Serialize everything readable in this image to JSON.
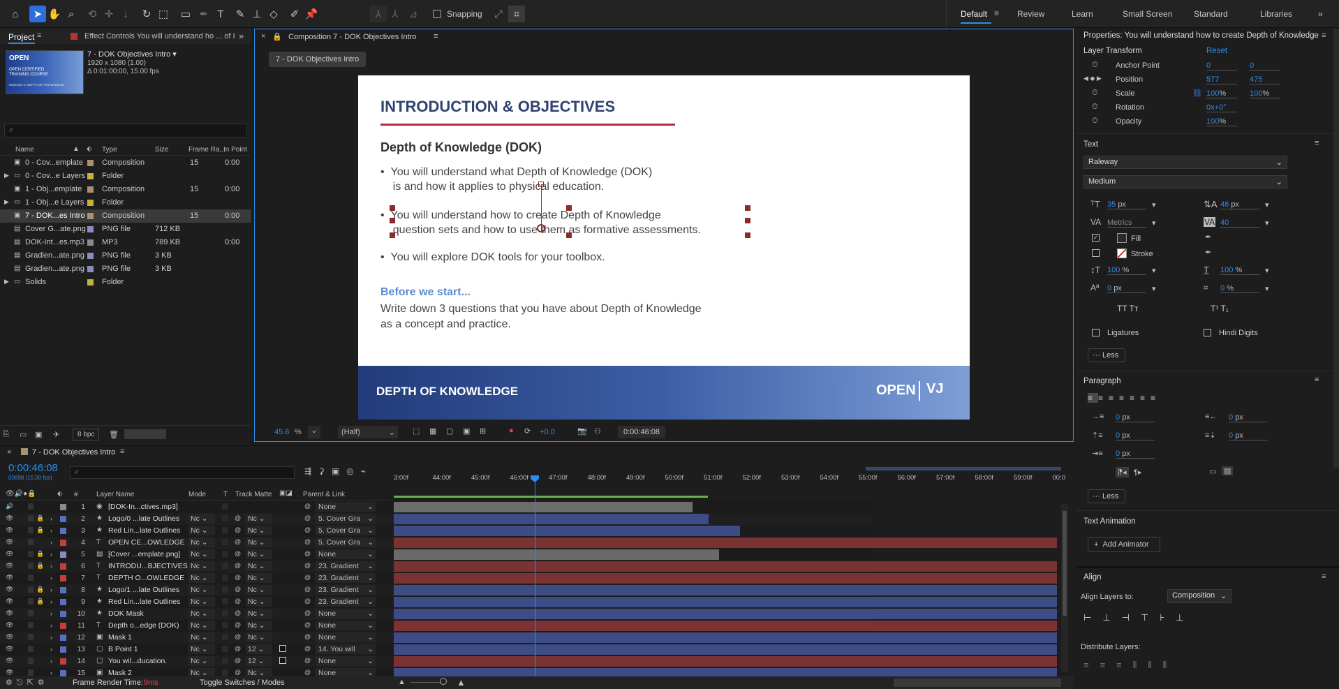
{
  "toolbar": {
    "snapping": "Snapping",
    "workspaces": [
      "Default",
      "Review",
      "Learn",
      "Small Screen",
      "Standard",
      "Libraries"
    ]
  },
  "project": {
    "tab": "Project",
    "effect_tab": "Effect Controls You will understand ho ... of K",
    "thumb_open": "OPEN",
    "thumb_sub": "OPEN CERTIFIED TRAINING COURSE",
    "thumb_sub2": "MODULE 2: DEPTH OF KNOWLEDGE",
    "comp_name": "7 - DOK Objectives Intro",
    "comp_res": "1920 x 1080 (1.00)",
    "comp_dur": "Δ 0:01:00:00, 15.00 fps",
    "headers": {
      "name": "Name",
      "type": "Type",
      "size": "Size",
      "frame": "Frame Ra...",
      "inpoint": "In Point"
    },
    "bpc": "8 bpc",
    "items": [
      {
        "name": "0 - Cov...emplate",
        "type": "Composition",
        "size": "",
        "frame": "15",
        "inpoint": "0:00",
        "color": "#a89070",
        "twirl": false
      },
      {
        "name": "0 - Cov...e Layers",
        "type": "Folder",
        "size": "",
        "frame": "",
        "inpoint": "",
        "color": "#c6b03c",
        "twirl": true
      },
      {
        "name": "1 - Obj...emplate",
        "type": "Composition",
        "size": "",
        "frame": "15",
        "inpoint": "0:00",
        "color": "#a89070",
        "twirl": false
      },
      {
        "name": "1 - Obj...e Layers",
        "type": "Folder",
        "size": "",
        "frame": "",
        "inpoint": "",
        "color": "#c6b03c",
        "twirl": true
      },
      {
        "name": "7 - DOK...es Intro",
        "type": "Composition",
        "size": "",
        "frame": "15",
        "inpoint": "0:00",
        "color": "#a89070",
        "twirl": false
      },
      {
        "name": "Cover G...ate.png",
        "type": "PNG file",
        "size": "712 KB",
        "frame": "",
        "inpoint": "",
        "color": "#8a8ac0",
        "twirl": false
      },
      {
        "name": "DOK-Int...es.mp3",
        "type": "MP3",
        "size": "789 KB",
        "frame": "",
        "inpoint": "0:00",
        "color": "#8a8a8a",
        "twirl": false
      },
      {
        "name": "Gradien...ate.png",
        "type": "PNG file",
        "size": "3 KB",
        "frame": "",
        "inpoint": "",
        "color": "#8a8ac0",
        "twirl": false
      },
      {
        "name": "Gradien...ate.png",
        "type": "PNG file",
        "size": "3 KB",
        "frame": "",
        "inpoint": "",
        "color": "#8a8ac0",
        "twirl": false
      },
      {
        "name": "Solids",
        "type": "Folder",
        "size": "",
        "frame": "",
        "inpoint": "",
        "color": "#c6b03c",
        "twirl": true
      }
    ]
  },
  "composition": {
    "tab": "Composition 7 - DOK Objectives Intro",
    "crumb": "7 - DOK Objectives Intro",
    "zoom": "45.6",
    "zoom_unit": "%",
    "resolution": "(Half)",
    "exposure": "+0.0",
    "time": "0:00:46:08",
    "slide": {
      "title": "INTRODUCTION & OBJECTIVES",
      "subtitle": "Depth of Knowledge (DOK)",
      "b1a": "You will understand what Depth of Knowledge (DOK)",
      "b1b": "is and how it applies to physical education.",
      "b2a": "You will understand how to create Depth of Knowledge",
      "b2b": "question sets and how to use them as formative assessments.",
      "b3": "You will explore DOK tools for your toolbox.",
      "before": "Before we start...",
      "write1": "Write down 3 questions that you have about Depth of Knowledge",
      "write2": "as a concept and practice.",
      "footer": "DEPTH OF KNOWLEDGE",
      "logo": "OPEN"
    }
  },
  "properties": {
    "title": "Properties: You will understand how to create Depth of Knowledge qu",
    "layer_transform": "Layer Transform",
    "reset": "Reset",
    "anchor_label": "Anchor Point",
    "anchor_x": "0",
    "anchor_y": "0",
    "position_label": "Position",
    "pos_x": "577",
    "pos_y": "475",
    "scale_label": "Scale",
    "scale_x": "100",
    "scale_y": "100",
    "pct": "%",
    "rotation_label": "Rotation",
    "rotation": "0x+0°",
    "opacity_label": "Opacity",
    "opacity": "100",
    "text_title": "Text",
    "font": "Raleway",
    "weight": "Medium",
    "size": "35",
    "size_unit": "px",
    "leading": "48",
    "leading_unit": "px",
    "kerning": "Metrics",
    "tracking": "40",
    "fill": "Fill",
    "stroke": "Stroke",
    "vscale": "100",
    "hscale": "100",
    "baseline": "0",
    "baseline_unit": "px",
    "tsume": "0",
    "tsume_unit": "%",
    "ligatures": "Ligatures",
    "hindi": "Hindi Digits",
    "less": "Less",
    "paragraph": "Paragraph",
    "indent_left": "0",
    "indent_right": "0",
    "space_before": "0",
    "space_after": "0",
    "indent_first": "0",
    "px": "px",
    "text_animation": "Text Animation",
    "add_animator": "Add Animator",
    "align": "Align",
    "align_to": "Align Layers to:",
    "align_target": "Composition",
    "distribute": "Distribute Layers:"
  },
  "timeline": {
    "tab": "7 - DOK Objectives Intro",
    "time": "0:00:46:08",
    "frames": "00698 (15.00 fps)",
    "headers": {
      "num": "#",
      "layer": "Layer Name",
      "mode": "Mode",
      "t": "T",
      "matte": "Track Matte",
      "parent": "Parent & Link"
    },
    "ruler": [
      "3:00f",
      "44:00f",
      "45:00f",
      "46:00f",
      "47:00f",
      "48:00f",
      "49:00f",
      "50:00f",
      "51:00f",
      "52:00f",
      "53:00f",
      "54:00f",
      "55:00f",
      "56:00f",
      "57:00f",
      "58:00f",
      "59:00f",
      "00:0"
    ],
    "render_time_label": "Frame Render Time:",
    "render_time": "9ms",
    "toggle": "Toggle Switches / Modes",
    "layers": [
      {
        "n": "1",
        "name": "[DOK-In...ctives.mp3]",
        "type": "audio",
        "color": "#8a8a8a",
        "mode": "",
        "matte": "",
        "parent": "None",
        "bar": "#6c6c6c",
        "barEnd": 0.45
      },
      {
        "n": "2",
        "name": "Logo/0 ...late Outlines",
        "type": "star",
        "color": "#5a6fc0",
        "mode": "Nc",
        "matte": "Nc",
        "parent": "5. Cover Gra",
        "bar": "#3d4c85",
        "barEnd": 0.475
      },
      {
        "n": "3",
        "name": "Red Lin...late Outlines",
        "type": "star",
        "color": "#5a6fc0",
        "mode": "Nc",
        "matte": "Nc",
        "parent": "5. Cover Gra",
        "bar": "#3d4c85",
        "barEnd": 0.522
      },
      {
        "n": "4",
        "name": "OPEN CE...OWLEDGE",
        "type": "T",
        "color": "#c04040",
        "mode": "Nc",
        "matte": "Nc",
        "parent": "5. Cover Gra",
        "bar": "#7a3232",
        "barEnd": 1
      },
      {
        "n": "5",
        "name": "[Cover ...emplate.png]",
        "type": "img",
        "color": "#8a8ac0",
        "mode": "Nc",
        "matte": "Nc",
        "parent": "None",
        "bar": "#6a6a6a",
        "barEnd": 0.49
      },
      {
        "n": "6",
        "name": "INTRODU...BJECTIVES",
        "type": "T",
        "color": "#c04040",
        "mode": "Nc",
        "matte": "Nc",
        "parent": "23. Gradient",
        "bar": "#7a3232",
        "barEnd": 1
      },
      {
        "n": "7",
        "name": "DEPTH O...OWLEDGE",
        "type": "T",
        "color": "#c04040",
        "mode": "Nc",
        "matte": "Nc",
        "parent": "23. Gradient",
        "bar": "#7a3232",
        "barEnd": 1
      },
      {
        "n": "8",
        "name": "Logo/1 ...late Outlines",
        "type": "star",
        "color": "#5a6fc0",
        "mode": "Nc",
        "matte": "Nc",
        "parent": "23. Gradient",
        "bar": "#3d4c85",
        "barEnd": 1
      },
      {
        "n": "9",
        "name": "Red Lin...late Outlines",
        "type": "star",
        "color": "#5a6fc0",
        "mode": "Nc",
        "matte": "Nc",
        "parent": "23. Gradient",
        "bar": "#3d4c85",
        "barEnd": 1
      },
      {
        "n": "10",
        "name": "DOK Mask",
        "type": "star",
        "color": "#5a6fc0",
        "mode": "Nc",
        "matte": "Nc",
        "parent": "None",
        "bar": "#3d4c85",
        "barEnd": 1
      },
      {
        "n": "11",
        "name": "Depth o...edge (DOK)",
        "type": "T",
        "color": "#c04040",
        "mode": "Nc",
        "matte": "Nc",
        "parent": "None",
        "bar": "#7a3232",
        "barEnd": 1
      },
      {
        "n": "12",
        "name": "Mask 1",
        "type": "shape",
        "color": "#5a6fc0",
        "mode": "Nc",
        "matte": "Nc",
        "parent": "None",
        "bar": "#3d4c85",
        "barEnd": 1
      },
      {
        "n": "13",
        "name": "B Point 1",
        "type": "null",
        "color": "#5a6fc0",
        "mode": "Nc",
        "matte": "12",
        "parent": "14. You will",
        "bar": "#3d4c85",
        "barEnd": 1
      },
      {
        "n": "14",
        "name": "You wil...ducation.",
        "type": "null",
        "color": "#c04040",
        "mode": "Nc",
        "matte": "12",
        "parent": "None",
        "bar": "#7a3232",
        "barEnd": 1
      },
      {
        "n": "15",
        "name": "Mask 2",
        "type": "shape",
        "color": "#5a6fc0",
        "mode": "Nc",
        "matte": "Nc",
        "parent": "None",
        "bar": "#3d4c85",
        "barEnd": 1
      }
    ]
  }
}
